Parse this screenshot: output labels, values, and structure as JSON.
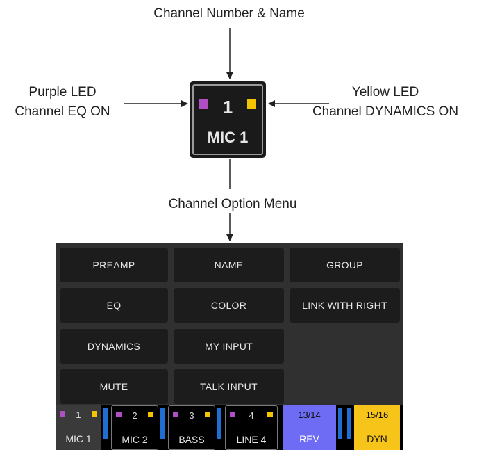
{
  "annotations": {
    "top": "Channel Number & Name",
    "left_line1": "Purple LED",
    "left_line2": "Channel EQ ON",
    "right_line1": "Yellow  LED",
    "right_line2": "Channel DYNAMICS ON",
    "middle": "Channel Option Menu"
  },
  "channel_box": {
    "number": "1",
    "name": "MIC 1"
  },
  "menu": {
    "buttons": [
      "PREAMP",
      "NAME",
      "GROUP",
      "EQ",
      "COLOR",
      "LINK WITH RIGHT",
      "DYNAMICS",
      "MY INPUT",
      "MUTE",
      "TALK INPUT"
    ]
  },
  "strip": {
    "channels": [
      {
        "number": "1",
        "name": "MIC 1"
      },
      {
        "number": "2",
        "name": "MIC 2"
      },
      {
        "number": "3",
        "name": "BASS"
      },
      {
        "number": "4",
        "name": "LINE 4"
      },
      {
        "number": "13/14",
        "name": "REV"
      },
      {
        "number": "15/16",
        "name": "DYN"
      }
    ]
  },
  "colors": {
    "led_purple": "#b04fc4",
    "led_yellow": "#f5c400",
    "rev_blue": "#6e6cf5",
    "dyn_yellow": "#f7c51a",
    "meter_blue": "#1e6fd1"
  }
}
